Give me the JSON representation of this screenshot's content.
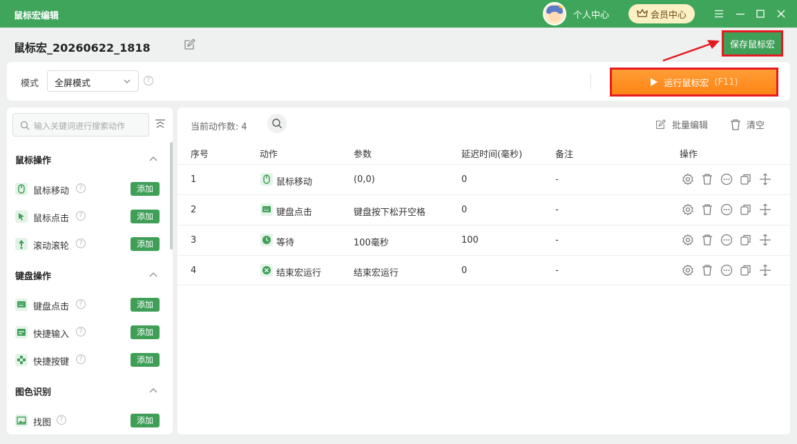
{
  "window": {
    "title": "鼠标宏编辑",
    "personal_center": "个人中心",
    "vip_center": "会员中心"
  },
  "header": {
    "macro_name": "鼠标宏_20260622_1818",
    "save_button": "保存鼠标宏"
  },
  "mode": {
    "label": "模式",
    "selected": "全屏模式",
    "run_button": "运行鼠标宏",
    "run_hotkey": "(F11)"
  },
  "sidebar": {
    "search_placeholder": "输入关键词进行搜索动作",
    "add_label": "添加",
    "groups": [
      {
        "title": "鼠标操作",
        "items": [
          {
            "label": "鼠标移动"
          },
          {
            "label": "鼠标点击"
          },
          {
            "label": "滚动滚轮"
          }
        ]
      },
      {
        "title": "键盘操作",
        "items": [
          {
            "label": "键盘点击"
          },
          {
            "label": "快捷输入"
          },
          {
            "label": "快捷按键"
          }
        ]
      },
      {
        "title": "图色识别",
        "items": [
          {
            "label": "找图"
          }
        ]
      }
    ]
  },
  "table": {
    "count_label": "当前动作数:",
    "count": "4",
    "batch_edit": "批量编辑",
    "clear": "清空",
    "headers": [
      "序号",
      "动作",
      "参数",
      "延迟时间(毫秒)",
      "备注",
      "操作"
    ],
    "rows": [
      {
        "index": "1",
        "action": "鼠标移动",
        "icon": "mouse-icon",
        "param": "(0,0)",
        "delay": "0",
        "note": "-"
      },
      {
        "index": "2",
        "action": "键盘点击",
        "icon": "keyboard-icon",
        "param": "键盘按下松开空格",
        "delay": "0",
        "note": "-"
      },
      {
        "index": "3",
        "action": "等待",
        "icon": "clock-icon",
        "param": "100毫秒",
        "delay": "100",
        "note": "-"
      },
      {
        "index": "4",
        "action": "结束宏运行",
        "icon": "stop-icon",
        "param": "结束宏运行",
        "delay": "0",
        "note": "-"
      }
    ]
  },
  "colors": {
    "primary": "#3fa55b",
    "button_green": "#3f9f57",
    "run_orange": "#ff8516",
    "annotation_red": "#e5191f"
  }
}
